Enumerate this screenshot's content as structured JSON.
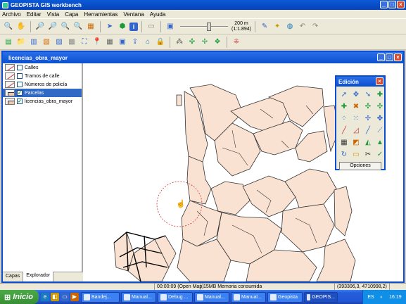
{
  "app": {
    "title": "GEOPISTA GIS workbench"
  },
  "menu": [
    "Archivo",
    "Editar",
    "Vista",
    "Capa",
    "Herramientas",
    "Ventana",
    "Ayuda"
  ],
  "toolbar": {
    "scale_distance": "200 m",
    "scale_ratio": "(1:1.894)",
    "slider_fraction": 0.62
  },
  "document": {
    "title": "licencias_obra_mayor"
  },
  "layers": [
    {
      "name": "Calles",
      "checked": false,
      "selected": false,
      "icon": "line-layer-icon"
    },
    {
      "name": "Tramos de calle",
      "checked": false,
      "selected": false,
      "icon": "line-layer-icon"
    },
    {
      "name": "Números de policía",
      "checked": false,
      "selected": false,
      "icon": "point-layer-icon"
    },
    {
      "name": "Parcelas",
      "checked": true,
      "selected": true,
      "icon": "polygon-layer-icon"
    },
    {
      "name": "licencias_obra_mayor",
      "checked": true,
      "selected": false,
      "icon": "polygon-layer-icon"
    }
  ],
  "panel_tabs": [
    "Capas",
    "Explorador"
  ],
  "edit_panel": {
    "title": "Edición",
    "options_label": "Opciones"
  },
  "status": {
    "time": "00:00:09 (Open Map)",
    "memory": "15MB Memoria consumida",
    "coords": "(393306,3, 4710998,2)"
  },
  "taskbar": {
    "start_label": "Inicio",
    "tasks": [
      "Bandej...",
      "Manual...",
      "Debug ...",
      "Manual...",
      "Manual...",
      "Geopista",
      "GEOPIS..."
    ],
    "lang": "ES",
    "clock": "16:19"
  },
  "colors": {
    "parcel_fill": "#fae2d2",
    "selection_blue": "#316ac5",
    "title_blue": "#0b4fd0"
  }
}
